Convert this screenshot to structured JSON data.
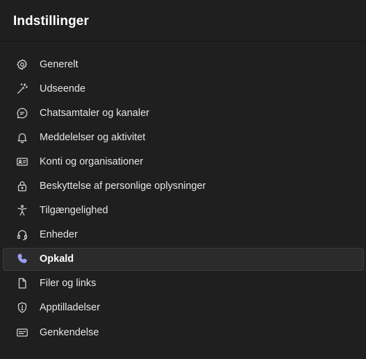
{
  "header": {
    "title": "Indstillinger"
  },
  "accent_color": "#9b9ff1",
  "menu": {
    "items": [
      {
        "label": "Generelt",
        "icon": "gear-icon"
      },
      {
        "label": "Udseende",
        "icon": "magic-wand-icon"
      },
      {
        "label": "Chatsamtaler og kanaler",
        "icon": "chat-bubble-icon"
      },
      {
        "label": "Meddelelser og aktivitet",
        "icon": "bell-icon"
      },
      {
        "label": "Konti og organisationer",
        "icon": "id-card-icon"
      },
      {
        "label": "Beskyttelse af personlige oplysninger",
        "icon": "lock-icon"
      },
      {
        "label": "Tilgængelighed",
        "icon": "accessibility-icon"
      },
      {
        "label": "Enheder",
        "icon": "headset-icon"
      },
      {
        "label": "Opkald",
        "icon": "phone-icon",
        "selected": true
      },
      {
        "label": "Filer og links",
        "icon": "document-icon"
      },
      {
        "label": "Apptilladelser",
        "icon": "shield-icon"
      },
      {
        "label": "Genkendelse",
        "icon": "caption-icon"
      }
    ]
  }
}
